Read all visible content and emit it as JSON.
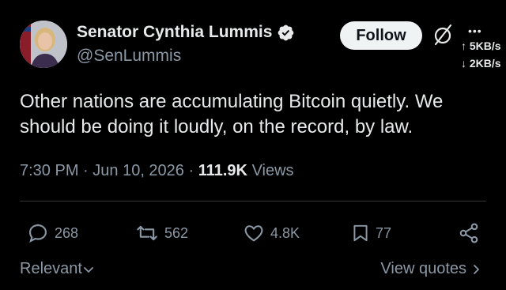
{
  "author": {
    "name": "Senator Cynthia Lummis",
    "handle": "@SenLummis"
  },
  "follow_label": "Follow",
  "network": {
    "dots": "•••",
    "upload": "↑ 5KB/s",
    "download": "↓ 2KB/s"
  },
  "tweet": {
    "text": "Other nations are accumulating Bitcoin quietly. We should be doing it loudly, on the record, by law.",
    "time": "7:30 PM",
    "date": "Jun 10, 2026",
    "views_count": "111.9K",
    "views_label": "Views"
  },
  "actions": {
    "replies": "268",
    "reposts": "562",
    "likes": "4.8K",
    "bookmarks": "77"
  },
  "footer": {
    "sort_label": "Relevant",
    "quotes_label": "View quotes"
  },
  "colors": {
    "background": "#000000",
    "text": "#e7e9ea",
    "muted": "#8b98a5",
    "verified": "#1d9bf0"
  }
}
